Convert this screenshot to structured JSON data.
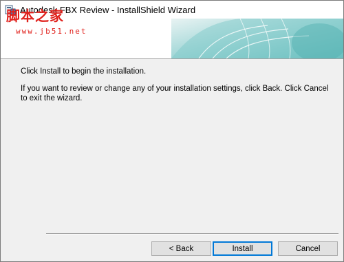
{
  "window": {
    "title": "Autodesk FBX Review - InstallShield Wizard",
    "watermark_text": "脚本之家",
    "watermark_url": "www.jb51.net"
  },
  "content": {
    "line1": "Click Install to begin the installation.",
    "line2": "If you want to review or change any of your installation settings, click Back. Click Cancel to exit the wizard."
  },
  "buttons": {
    "back": "< Back",
    "install": "Install",
    "cancel": "Cancel"
  }
}
